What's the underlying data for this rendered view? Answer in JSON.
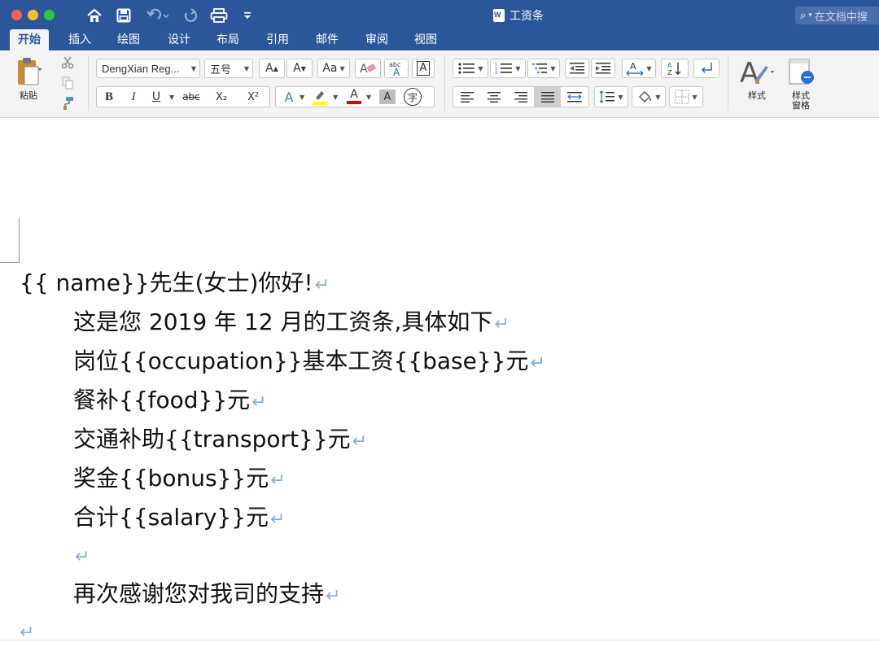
{
  "window": {
    "title": "工资条",
    "search_placeholder": "在文档中搜"
  },
  "tabs": [
    "开始",
    "插入",
    "绘图",
    "设计",
    "布局",
    "引用",
    "邮件",
    "审阅",
    "视图"
  ],
  "active_tab": "开始",
  "ribbon": {
    "paste_label": "粘贴",
    "font_name": "DengXian Reg...",
    "font_size": "五号",
    "styles_label": "样式",
    "styles_pane_label": "样式\n窗格",
    "bold": "B",
    "italic": "I",
    "underline": "U",
    "strike": "abc",
    "subscript": "X₂",
    "superscript": "X²",
    "grow": "A",
    "shrink": "A",
    "font_color_letter": "A",
    "char_shading": "A",
    "enclose_char": "字",
    "highlight_color": "#ffff00",
    "font_color": "#e00000"
  },
  "document": {
    "lines": [
      "{{ name}}先生(女士)你好!",
      "这是您 2019 年 12 月的工资条,具体如下",
      "岗位{{occupation}}基本工资{{base}}元",
      "餐补{{food}}元",
      "交通补助{{transport}}元",
      "奖金{{bonus}}元",
      "合计{{salary}}元",
      "",
      "再次感谢您对我司的支持",
      ""
    ],
    "paragraph_mark": "↵"
  }
}
